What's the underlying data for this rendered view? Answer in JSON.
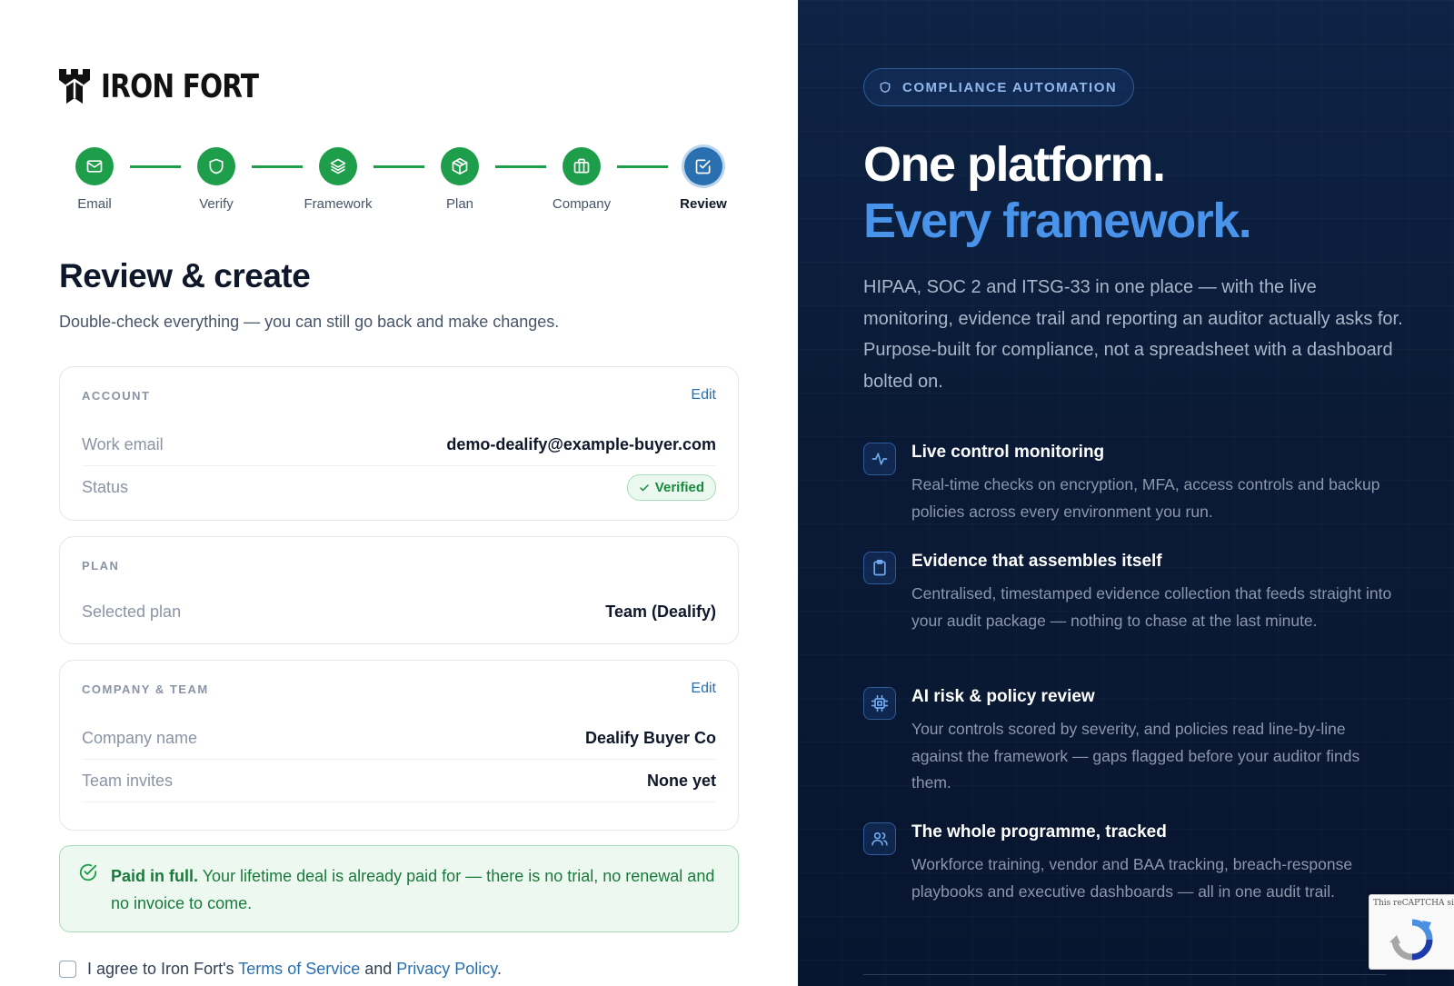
{
  "brand": {
    "name": "IRON FORT"
  },
  "stepper": {
    "steps": [
      {
        "label": "Email",
        "icon": "mail-icon",
        "state": "complete"
      },
      {
        "label": "Verify",
        "icon": "shield-icon",
        "state": "complete"
      },
      {
        "label": "Framework",
        "icon": "layers-icon",
        "state": "complete"
      },
      {
        "label": "Plan",
        "icon": "box-icon",
        "state": "complete"
      },
      {
        "label": "Company",
        "icon": "briefcase-icon",
        "state": "complete"
      },
      {
        "label": "Review",
        "icon": "checkbox-icon",
        "state": "current"
      }
    ]
  },
  "page": {
    "title": "Review & create",
    "subtitle": "Double-check everything — you can still go back and make changes."
  },
  "account": {
    "label": "ACCOUNT",
    "edit": "Edit",
    "email_key": "Work email",
    "email_value": "demo-dealify@example-buyer.com",
    "status_key": "Status",
    "status_value": "Verified"
  },
  "plan": {
    "label": "PLAN",
    "selected_key": "Selected plan",
    "selected_value": "Team (Dealify)"
  },
  "company": {
    "label": "COMPANY & TEAM",
    "edit": "Edit",
    "name_key": "Company name",
    "name_value": "Dealify Buyer Co",
    "invites_key": "Team invites",
    "invites_value": "None yet"
  },
  "notice": {
    "strong": "Paid in full.",
    "text": " Your lifetime deal is already paid for — there is no trial, no renewal and no invoice to come."
  },
  "agree": {
    "prefix": "I agree to Iron Fort's ",
    "terms": "Terms of Service",
    "and": " and ",
    "privacy": "Privacy Policy",
    "suffix": "."
  },
  "promo": {
    "pill": "COMPLIANCE AUTOMATION",
    "headline_1": "One platform.",
    "headline_2": "Every framework.",
    "lead": "HIPAA, SOC 2 and ITSG-33 in one place — with the live monitoring, evidence trail and reporting an auditor actually asks for. Purpose-built for compliance, not a spreadsheet with a dashboard bolted on.",
    "features": [
      {
        "icon": "activity-icon",
        "title": "Live control monitoring",
        "desc": "Real-time checks on encryption, MFA, access controls and backup policies across every environment you run."
      },
      {
        "icon": "clipboard-icon",
        "title": "Evidence that assembles itself",
        "desc": "Centralised, timestamped evidence collection that feeds straight into your audit package — nothing to chase at the last minute."
      },
      {
        "icon": "cpu-icon",
        "title": "AI risk & policy review",
        "desc": "Your controls scored by severity, and policies read line-by-line against the framework — gaps flagged before your auditor finds them."
      },
      {
        "icon": "users-icon",
        "title": "The whole programme, tracked",
        "desc": "Workforce training, vendor and BAA tracking, breach-response playbooks and executive dashboards — all in one audit trail."
      }
    ]
  },
  "recaptcha": {
    "text": "This reCAPTCHA site admin   you a"
  },
  "colors": {
    "success": "#1e9e4b",
    "accent": "#2a6fb0",
    "panel": "#0a1a36",
    "highlight": "#4a93ea"
  }
}
